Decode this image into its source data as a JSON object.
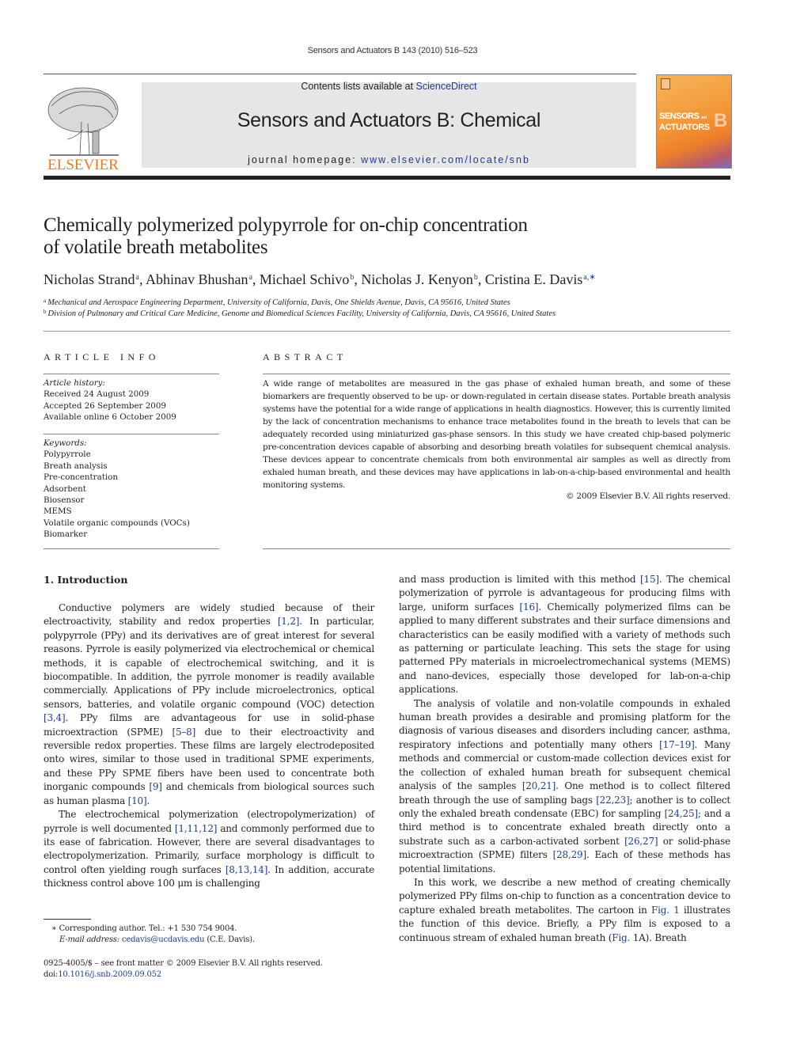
{
  "header": {
    "running_head": "Sensors and Actuators B 143 (2010) 516–523",
    "publisher_logo_text": "ELSEVIER",
    "contents_prefix": "Contents lists available at ",
    "contents_link": "ScienceDirect",
    "journal_title": "Sensors and Actuators B: Chemical",
    "homepage_prefix": "journal homepage: ",
    "homepage_link": "www.elsevier.com/locate/snb",
    "cover_text_line1": "SENSORS",
    "cover_text_small": "and",
    "cover_text_line2": "ACTUATORS",
    "cover_letter": "B",
    "colors": {
      "publisher_orange": "#f07a1a",
      "link_blue": "#1f3c8c",
      "banner_gray": "#e6e6e6"
    }
  },
  "article": {
    "title_line1": "Chemically polymerized polypyrrole for on-chip concentration",
    "title_line2": "of volatile breath metabolites",
    "authors": [
      {
        "name": "Nicholas Strand",
        "affil": "a"
      },
      {
        "name": "Abhinav Bhushan",
        "affil": "a"
      },
      {
        "name": "Michael Schivo",
        "affil": "b"
      },
      {
        "name": "Nicholas J. Kenyon",
        "affil": "b"
      },
      {
        "name": "Cristina E. Davis",
        "affil": "a,∗"
      }
    ],
    "affiliations": [
      {
        "mark": "a",
        "text": "Mechanical and Aerospace Engineering Department, University of California, Davis, One Shields Avenue, Davis, CA 95616, United States"
      },
      {
        "mark": "b",
        "text": "Division of Pulmonary and Critical Care Medicine, Genome and Biomedical Sciences Facility, University of California, Davis, CA 95616, United States"
      }
    ]
  },
  "article_info": {
    "heading": "ARTICLE INFO",
    "history_label": "Article history:",
    "history": [
      "Received 24 August 2009",
      "Accepted 26 September 2009",
      "Available online 6 October 2009"
    ],
    "keywords_label": "Keywords:",
    "keywords": [
      "Polypyrrole",
      "Breath analysis",
      "Pre-concentration",
      "Adsorbent",
      "Biosensor",
      "MEMS",
      "Volatile organic compounds (VOCs)",
      "Biomarker"
    ]
  },
  "abstract": {
    "heading": "ABSTRACT",
    "text": "A wide range of metabolites are measured in the gas phase of exhaled human breath, and some of these biomarkers are frequently observed to be up- or down-regulated in certain disease states. Portable breath analysis systems have the potential for a wide range of applications in health diagnostics. However, this is currently limited by the lack of concentration mechanisms to enhance trace metabolites found in the breath to levels that can be adequately recorded using miniaturized gas-phase sensors. In this study we have created chip-based polymeric pre-concentration devices capable of absorbing and desorbing breath volatiles for subsequent chemical analysis. These devices appear to concentrate chemicals from both environmental air samples as well as directly from exhaled human breath, and these devices may have applications in lab-on-a-chip-based environmental and health monitoring systems.",
    "copyright": "© 2009 Elsevier B.V. All rights reserved."
  },
  "body": {
    "section_heading": "1.  Introduction",
    "left_paragraphs": [
      [
        {
          "t": "Conductive polymers are widely studied because of their electroactivity, stability and redox properties "
        },
        {
          "ref": "[1,2]"
        },
        {
          "t": ". In particular, polypyrrole (PPy) and its derivatives are of great interest for several reasons. Pyrrole is easily polymerized via electrochemical or chemical methods, it is capable of electrochemical switching, and it is biocompatible. In addition, the pyrrole monomer is readily available commercially. Applications of PPy include microelectronics, optical sensors, batteries, and volatile organic compound (VOC) detection "
        },
        {
          "ref": "[3,4]"
        },
        {
          "t": ". PPy films are advantageous for use in solid-phase microextraction (SPME) "
        },
        {
          "ref": "[5–8]"
        },
        {
          "t": " due to their electroactivity and reversible redox properties. These films are largely electrodeposited onto wires, similar to those used in traditional SPME experiments, and these PPy SPME fibers have been used to concentrate both inorganic compounds "
        },
        {
          "ref": "[9]"
        },
        {
          "t": " and chemicals from biological sources such as human plasma "
        },
        {
          "ref": "[10]"
        },
        {
          "t": "."
        }
      ],
      [
        {
          "t": "The electrochemical polymerization (electropolymerization) of pyrrole is well documented "
        },
        {
          "ref": "[1,11,12]"
        },
        {
          "t": " and commonly performed due to its ease of fabrication. However, there are several disadvantages to electropolymerization. Primarily, surface morphology is difficult to control often yielding rough surfaces "
        },
        {
          "ref": "[8,13,14]"
        },
        {
          "t": ". In addition, accurate thickness control above 100 μm is challenging"
        }
      ]
    ],
    "right_paragraphs": [
      [
        {
          "t": "and mass production is limited with this method "
        },
        {
          "ref": "[15]"
        },
        {
          "t": ". The chemical polymerization of pyrrole is advantageous for producing films with large, uniform surfaces "
        },
        {
          "ref": "[16]"
        },
        {
          "t": ". Chemically polymerized films can be applied to many different substrates and their surface dimensions and characteristics can be easily modified with a variety of methods such as patterning or particulate leaching. This sets the stage for using patterned PPy materials in microelectromechanical systems (MEMS) and nano-devices, especially those developed for lab-on-a-chip applications."
        }
      ],
      [
        {
          "t": "The analysis of volatile and non-volatile compounds in exhaled human breath provides a desirable and promising platform for the diagnosis of various diseases and disorders including cancer, asthma, respiratory infections and potentially many others "
        },
        {
          "ref": "[17–19]"
        },
        {
          "t": ". Many methods and commercial or custom-made collection devices exist for the collection of exhaled human breath for subsequent chemical analysis of the samples "
        },
        {
          "ref": "[20,21]"
        },
        {
          "t": ". One method is to collect filtered breath through the use of sampling bags "
        },
        {
          "ref": "[22,23]"
        },
        {
          "t": "; another is to collect only the exhaled breath condensate (EBC) for sampling "
        },
        {
          "ref": "[24,25]"
        },
        {
          "t": "; and a third method is to concentrate exhaled breath directly onto a substrate such as a carbon-activated sorbent "
        },
        {
          "ref": "[26,27]"
        },
        {
          "t": " or solid-phase microextraction (SPME) filters "
        },
        {
          "ref": "[28,29]"
        },
        {
          "t": ". Each of these methods has potential limitations."
        }
      ],
      [
        {
          "t": "In this work, we describe a new method of creating chemically polymerized PPy films on-chip to function as a concentration device to capture exhaled breath metabolites. The cartoon in "
        },
        {
          "ref": "Fig. 1"
        },
        {
          "t": " illustrates the function of this device. Briefly, a PPy film is exposed to a continuous stream of exhaled human breath ("
        },
        {
          "ref": "Fig."
        },
        {
          "t": " 1A). Breath"
        }
      ]
    ]
  },
  "footnotes": {
    "corresponding": "∗  Corresponding author. Tel.: +1 530 754 9004.",
    "email_label": "E-mail address: ",
    "email": "cedavis@ucdavis.edu",
    "email_suffix": " (C.E. Davis).",
    "front_matter": "0925-4005/$ – see front matter © 2009 Elsevier B.V. All rights reserved.",
    "doi_prefix": "doi:",
    "doi": "10.1016/j.snb.2009.09.052"
  }
}
